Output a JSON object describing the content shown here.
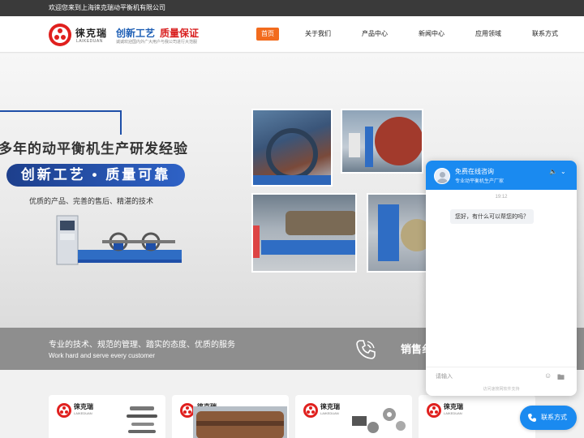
{
  "topbar": {
    "welcome": "欢迎您来到上海徕克瑞动平衡机有限公司"
  },
  "header": {
    "logo_cn": "徕克瑞",
    "logo_en": "LAIKEDUAN",
    "slogan_blue": "创新工艺",
    "slogan_red": "质量保证",
    "slogan_sub": "诚诚欢迎国内外广大用户与我公司进行大范服",
    "nav": [
      "首页",
      "关于我们",
      "产品中心",
      "新闻中心",
      "应用领域",
      "联系方式"
    ],
    "nav_active_index": 0
  },
  "banner": {
    "headline": "多年的动平衡机生产研发经验",
    "pill": "创新工艺 • 质量可靠",
    "sub": "优质的产品、完善的售后、精湛的技术"
  },
  "strip": {
    "line1": "专业的技术、规范的管理、踏实的态度、优质的服务",
    "line2": "Work hard and serve every customer",
    "hotline": "销售纟"
  },
  "cards": [
    {
      "logo_cn": "徕克瑞",
      "logo_en": "LAIKEDUAN"
    },
    {
      "logo_cn": "徕克瑞",
      "logo_en": "LAIKEDUAN"
    },
    {
      "logo_cn": "徕克瑞",
      "logo_en": "LAIKEDUAN"
    },
    {
      "logo_cn": "徕克瑞",
      "logo_en": "LAIKEDUAN"
    }
  ],
  "chat": {
    "title": "免费在线咨询",
    "subtitle": "专业动平衡机生产厂家",
    "time": "19:12",
    "message": "您好，有什么可以帮您的吗？",
    "input_placeholder": "请输入",
    "footer": "访问速搜网软件支持"
  },
  "contact_button": "联系方式",
  "colors": {
    "brand_red": "#e0201e",
    "brand_blue": "#1e4fa8",
    "nav_active": "#f26b1d",
    "chat_blue": "#1a8af0"
  }
}
